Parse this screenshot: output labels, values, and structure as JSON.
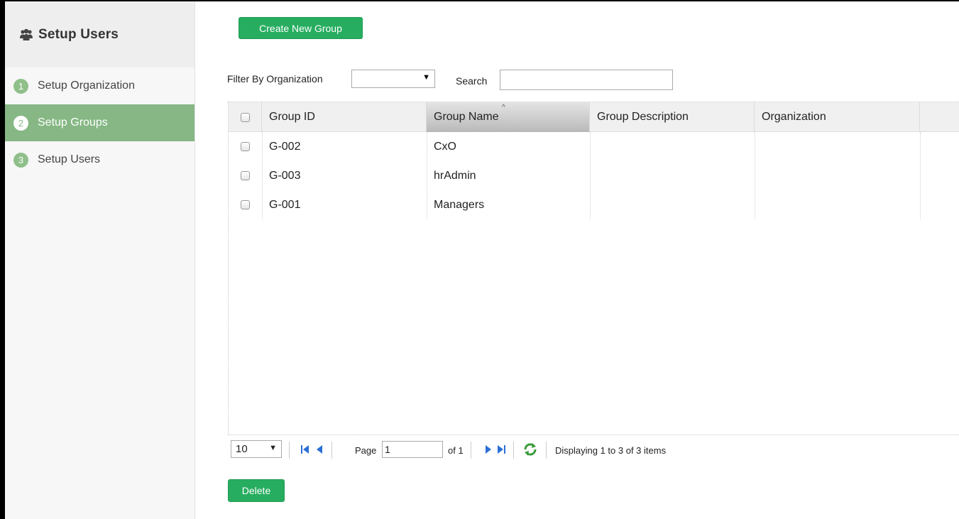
{
  "sidebar": {
    "title": "Setup Users",
    "header_icon": "users-icon",
    "items": [
      {
        "num": "1",
        "label": "Setup Organization",
        "active": false
      },
      {
        "num": "2",
        "label": "Setup Groups",
        "active": true
      },
      {
        "num": "3",
        "label": "Setup Users",
        "active": false
      }
    ]
  },
  "toolbar": {
    "create_label": "Create New Group",
    "delete_label": "Delete"
  },
  "filter": {
    "org_label": "Filter By Organization",
    "org_value": "",
    "search_label": "Search",
    "search_value": ""
  },
  "grid": {
    "columns": [
      "Group ID",
      "Group Name",
      "Group Description",
      "Organization"
    ],
    "sorted_column": "Group Name",
    "rows": [
      {
        "id": "G-002",
        "name": "CxO",
        "description": "",
        "organization": ""
      },
      {
        "id": "G-003",
        "name": "hrAdmin",
        "description": "",
        "organization": ""
      },
      {
        "id": "G-001",
        "name": "Managers",
        "description": "",
        "organization": ""
      }
    ]
  },
  "pager": {
    "page_size": "10",
    "page_label": "Page",
    "page_value": "1",
    "of_label": "of 1",
    "display_text": "Displaying 1 to 3 of 3 items"
  },
  "colors": {
    "accent_green": "#27ad60",
    "sidebar_active": "#86b784",
    "step_badge": "#8fbf8a"
  }
}
